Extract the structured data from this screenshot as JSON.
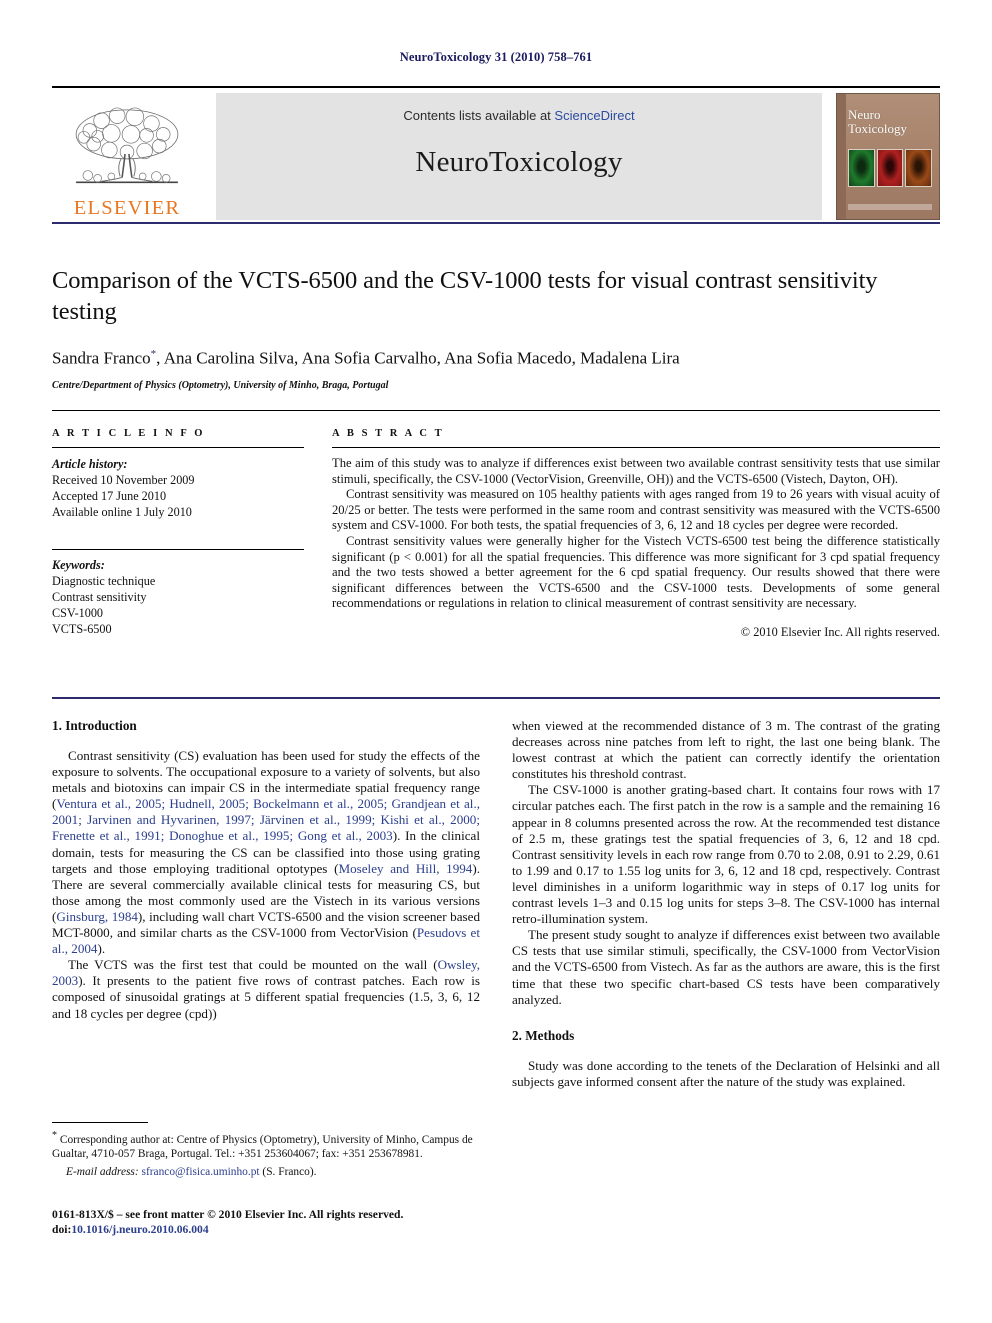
{
  "running_head": "NeuroToxicology 31 (2010) 758–761",
  "masthead": {
    "elsevier_wordmark": "ELSEVIER",
    "contents_prefix": "Contents lists available at ",
    "sciencedirect": "ScienceDirect",
    "journal_name": "NeuroToxicology",
    "cover": {
      "line1": "Neuro",
      "line2": "Toxicology"
    }
  },
  "title": "Comparison of the VCTS-6500 and the CSV-1000 tests for visual contrast sensitivity testing",
  "authors": "Sandra Franco",
  "authors_rest": ", Ana Carolina Silva, Ana Sofia Carvalho, Ana Sofia Macedo, Madalena Lira",
  "author_marker": "*",
  "affiliation": "Centre/Department of Physics (Optometry), University of Minho, Braga, Portugal",
  "article_info": {
    "label": "A R T I C L E   I N F O",
    "history_head": "Article history:",
    "received": "Received 10 November 2009",
    "accepted": "Accepted 17 June 2010",
    "available": "Available online 1 July 2010",
    "keywords_head": "Keywords:",
    "keywords": [
      "Diagnostic technique",
      "Contrast sensitivity",
      "CSV-1000",
      "VCTS-6500"
    ]
  },
  "abstract": {
    "label": "A B S T R A C T",
    "p1": "The aim of this study was to analyze if differences exist between two available contrast sensitivity tests that use similar stimuli, specifically, the CSV-1000 (VectorVision, Greenville, OH)) and the VCTS-6500 (Vistech, Dayton, OH).",
    "p2": "Contrast sensitivity was measured on 105 healthy patients with ages ranged from 19 to 26 years with visual acuity of 20/25 or better. The tests were performed in the same room and contrast sensitivity was measured with the VCTS-6500 system and CSV-1000. For both tests, the spatial frequencies of 3, 6, 12 and 18 cycles per degree were recorded.",
    "p3": "Contrast sensitivity values were generally higher for the Vistech VCTS-6500 test being the difference statistically significant (p < 0.001) for all the spatial frequencies. This difference was more significant for 3 cpd spatial frequency and the two tests showed a better agreement for the 6 cpd spatial frequency. Our results showed that there were significant differences between the VCTS-6500 and the CSV-1000 tests. Developments of some general recommendations or regulations in relation to clinical measurement of contrast sensitivity are necessary.",
    "copyright": "© 2010 Elsevier Inc. All rights reserved."
  },
  "sections": {
    "introduction_heading": "1. Introduction",
    "methods_heading": "2. Methods",
    "intro_p1_a": "Contrast sensitivity (CS) evaluation has been used for study the effects of the exposure to solvents. The occupational exposure to a variety of solvents, but also metals and biotoxins can impair CS in the intermediate spatial frequency range (",
    "intro_p1_cites": "Ventura et al., 2005; Hudnell, 2005; Bockelmann et al., 2005; Grandjean et al., 2001; Jarvinen and Hyvarinen, 1997; Järvinen et al., 1999; Kishi et al., 2000; Frenette et al., 1991; Donoghue et al., 1995; Gong et al., 2003",
    "intro_p1_b": "). In the clinical domain, tests for measuring the CS can be classified into those using grating targets and those employing traditional optotypes (",
    "intro_p1_cite2": "Moseley and Hill, 1994",
    "intro_p1_c": "). There are several commercially available clinical tests for measuring CS, but those among the most commonly used are the Vistech in its various versions (",
    "intro_p1_cite3": "Ginsburg, 1984",
    "intro_p1_d": "), including wall chart VCTS-6500 and the vision screener based MCT-8000, and similar charts as the CSV-1000 from VectorVision (",
    "intro_p1_cite4": "Pesudovs et al., 2004",
    "intro_p1_e": ").",
    "intro_p2_a": "The VCTS was the first test that could be mounted on the wall (",
    "intro_p2_cite": "Owsley, 2003",
    "intro_p2_b": "). It presents to the patient five rows of contrast patches. Each row is composed of sinusoidal gratings at 5 different spatial frequencies (1.5, 3, 6, 12 and 18 cycles per degree (cpd))",
    "intro_p2_cont": "when viewed at the recommended distance of 3 m. The contrast of the grating decreases across nine patches from left to right, the last one being blank. The lowest contrast at which the patient can correctly identify the orientation constitutes his threshold contrast.",
    "intro_p3": "The CSV-1000 is another grating-based chart. It contains four rows with 17 circular patches each. The first patch in the row is a sample and the remaining 16 appear in 8 columns presented across the row. At the recommended test distance of 2.5 m, these gratings test the spatial frequencies of 3, 6, 12 and 18 cpd. Contrast sensitivity levels in each row range from 0.70 to 2.08, 0.91 to 2.29, 0.61 to 1.99 and 0.17 to 1.55 log units for 3, 6, 12 and 18 cpd, respectively. Contrast level diminishes in a uniform logarithmic way in steps of 0.17 log units for contrast levels 1–3 and 0.15 log units for steps 3–8. The CSV-1000 has internal retro-illumination system.",
    "intro_p4": "The present study sought to analyze if differences exist between two available CS tests that use similar stimuli, specifically, the CSV-1000 from VectorVision and the VCTS-6500 from Vistech. As far as the authors are aware, this is the first time that these two specific chart-based CS tests have been comparatively analyzed.",
    "methods_p1": "Study was done according to the tenets of the Declaration of Helsinki and all subjects gave informed consent after the nature of the study was explained."
  },
  "footnote": {
    "marker": "*",
    "text": " Corresponding author at: Centre of Physics (Optometry), University of Minho, Campus de Gualtar, 4710-057 Braga, Portugal. Tel.: +351 253604067; fax: +351 253678981.",
    "email_label": "E-mail address:",
    "email": "sfranco@fisica.uminho.pt",
    "email_suffix": " (S. Franco)."
  },
  "page_footer": {
    "line1": "0161-813X/$ – see front matter © 2010 Elsevier Inc. All rights reserved.",
    "doi_prefix": "doi:",
    "doi": "10.1016/j.neuro.2010.06.004"
  },
  "colors": {
    "link": "#2b3f8c",
    "elsevier_orange": "#e87722",
    "rule_navy": "#2b2b6e",
    "banner_gray": "#e3e3e3"
  }
}
